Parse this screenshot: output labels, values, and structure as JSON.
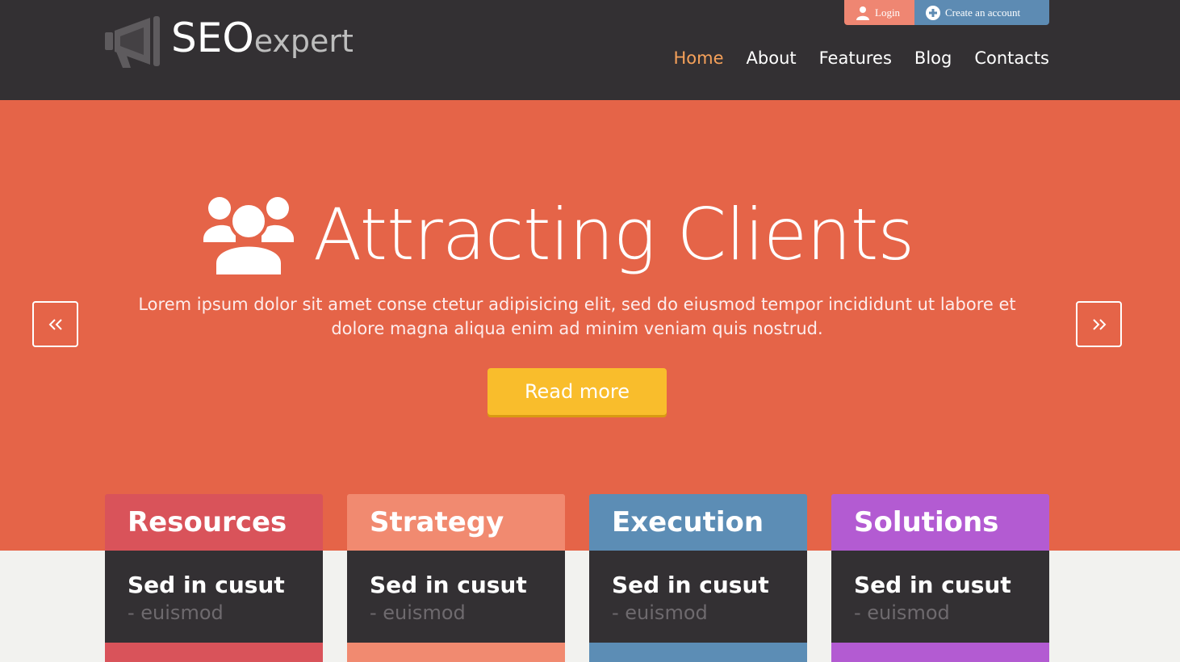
{
  "logo": {
    "brand_main": "SEO",
    "brand_sub": "expert",
    "icon": "megaphone-icon"
  },
  "auth": {
    "login_label": "Login",
    "create_label": "Create an account",
    "login_icon": "user-icon",
    "create_icon": "plus-circle-icon"
  },
  "nav": {
    "items": [
      {
        "label": "Home",
        "active": true
      },
      {
        "label": "About"
      },
      {
        "label": "Features"
      },
      {
        "label": "Blog"
      },
      {
        "label": "Contacts"
      }
    ]
  },
  "hero": {
    "icon": "users-group-icon",
    "title": "Attracting Clients",
    "text": "Lorem ipsum dolor sit amet conse ctetur adipisicing elit, sed do eiusmod tempor incididunt ut labore et dolore magna aliqua enim ad minim veniam quis nostrud.",
    "cta_label": "Read more",
    "prev_icon": "double-chevron-left-icon",
    "next_icon": "double-chevron-right-icon"
  },
  "cards": [
    {
      "title": "Resources",
      "line1": "Sed in cusut",
      "line2": "- euismod",
      "color": "#d9535a"
    },
    {
      "title": "Strategy",
      "line1": "Sed in cusut",
      "line2": "- euismod",
      "color": "#f18a70"
    },
    {
      "title": "Execution",
      "line1": "Sed in cusut",
      "line2": "- euismod",
      "color": "#5c8db5"
    },
    {
      "title": "Solutions",
      "line1": "Sed in cusut",
      "line2": "- euismod",
      "color": "#b35bd2"
    }
  ],
  "colors": {
    "header_bg": "#333033",
    "hero_bg": "#e56448",
    "accent_nav": "#f6a15a",
    "cta": "#f9bd2c",
    "page_bg": "#f2f2ef"
  }
}
